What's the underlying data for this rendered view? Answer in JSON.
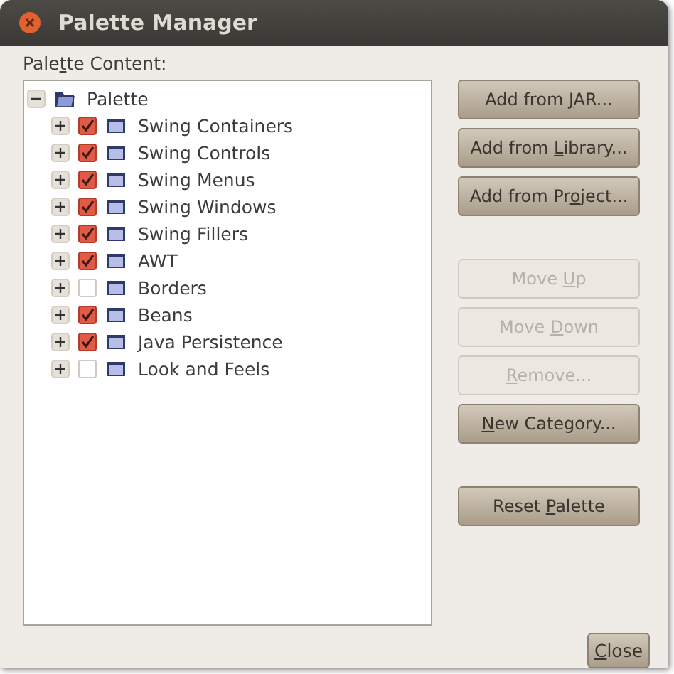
{
  "window": {
    "title": "Palette Manager"
  },
  "content_label": {
    "before": "Pale",
    "mnemonic": "t",
    "after": "te Content:"
  },
  "tree": {
    "label": "Palette",
    "expanded": true,
    "children": [
      {
        "label": "Swing Containers",
        "checked": true,
        "expanded": false
      },
      {
        "label": "Swing Controls",
        "checked": true,
        "expanded": false
      },
      {
        "label": "Swing Menus",
        "checked": true,
        "expanded": false
      },
      {
        "label": "Swing Windows",
        "checked": true,
        "expanded": false
      },
      {
        "label": "Swing Fillers",
        "checked": true,
        "expanded": false
      },
      {
        "label": "AWT",
        "checked": true,
        "expanded": false
      },
      {
        "label": "Borders",
        "checked": false,
        "expanded": false
      },
      {
        "label": "Beans",
        "checked": true,
        "expanded": false
      },
      {
        "label": "Java Persistence",
        "checked": true,
        "expanded": false
      },
      {
        "label": "Look and Feels",
        "checked": false,
        "expanded": false
      }
    ]
  },
  "button_groups": [
    [
      {
        "before": "Add from ",
        "mnemonic": "J",
        "after": "AR...",
        "disabled": false
      },
      {
        "before": "Add from ",
        "mnemonic": "L",
        "after": "ibrary...",
        "disabled": false
      },
      {
        "before": "Add from Pr",
        "mnemonic": "o",
        "after": "ject...",
        "disabled": false
      }
    ],
    [
      {
        "before": "Move ",
        "mnemonic": "U",
        "after": "p",
        "disabled": true
      },
      {
        "before": "Move ",
        "mnemonic": "D",
        "after": "own",
        "disabled": true
      },
      {
        "mnemonic": "R",
        "after": "emove...",
        "disabled": true
      },
      {
        "mnemonic": "N",
        "after": "ew Category...",
        "disabled": false
      }
    ],
    [
      {
        "before": "Reset ",
        "mnemonic": "P",
        "after": "alette",
        "disabled": false
      }
    ]
  ],
  "close_button": {
    "mnemonic": "C",
    "after": "lose",
    "disabled": false
  }
}
